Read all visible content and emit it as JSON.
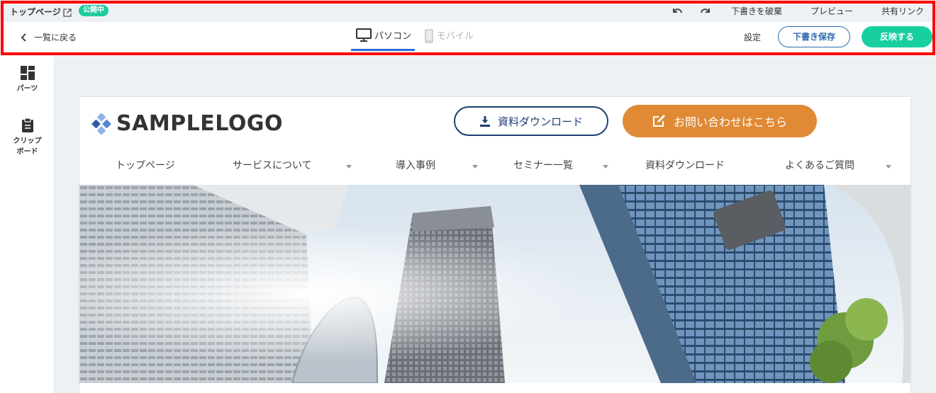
{
  "editor": {
    "page_name": "トップページ",
    "status_badge": "公開中",
    "discard_label": "下書きを破棄",
    "preview_label": "プレビュー",
    "share_label": "共有リンク",
    "back_label": "一覧に戻る",
    "tab_pc": "パソコン",
    "tab_mobile": "モバイル",
    "settings_label": "設定",
    "save_draft_label": "下書き保存",
    "publish_label": "反映する",
    "active_tab_color": "#2a6fd6",
    "badge_color": "#1ecc9f",
    "publish_color": "#18cfa0",
    "highlight_color": "#ff0000"
  },
  "sidebar": {
    "items": [
      {
        "label": "パーツ",
        "icon": "dashboard-icon"
      },
      {
        "label_line1": "クリップ",
        "label_line2": "ボード",
        "icon": "clipboard-icon"
      }
    ]
  },
  "site": {
    "logo_text": "SAMPLELOGO",
    "download_label": "資料ダウンロード",
    "contact_label": "お問い合わせはこちら",
    "download_color": "#1e3f73",
    "contact_color": "#e08a35",
    "nav": [
      {
        "label": "トップページ",
        "dropdown": false
      },
      {
        "label": "サービスについて",
        "dropdown": true
      },
      {
        "label": "導入事例",
        "dropdown": true
      },
      {
        "label": "セミナー一覧",
        "dropdown": true
      },
      {
        "label": "資料ダウンロード",
        "dropdown": false
      },
      {
        "label": "よくあるご質問",
        "dropdown": true
      }
    ]
  }
}
